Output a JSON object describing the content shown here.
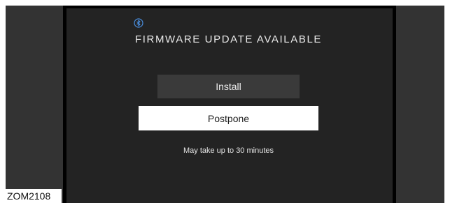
{
  "dialog": {
    "title": "FIRMWARE UPDATE AVAILABLE",
    "icon": "bluetooth-icon",
    "install_label": "Install",
    "postpone_label": "Postpone",
    "note": "May take up to 30 minutes"
  },
  "figure": {
    "code": "ZOM2108"
  },
  "colors": {
    "screen_bg": "#232323",
    "side_panel": "#333333",
    "install_bg": "#3a3a3a",
    "postpone_bg": "#ffffff",
    "icon_accent": "#4a8fe0"
  }
}
